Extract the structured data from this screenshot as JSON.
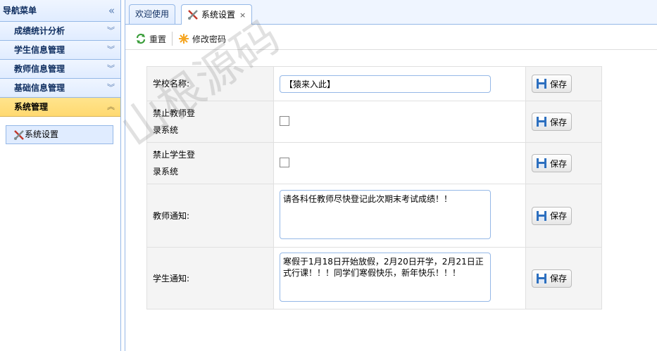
{
  "sidebar": {
    "title": "导航菜单",
    "collapse_glyph": "«",
    "groups": [
      {
        "label": "成绩统计分析",
        "expanded": false
      },
      {
        "label": "学生信息管理",
        "expanded": false
      },
      {
        "label": "教师信息管理",
        "expanded": false
      },
      {
        "label": "基础信息管理",
        "expanded": false
      },
      {
        "label": "系统管理",
        "expanded": true
      }
    ],
    "submenu": [
      {
        "label": "系统设置"
      }
    ]
  },
  "tabs": [
    {
      "label": "欢迎使用",
      "selected": false
    },
    {
      "label": "系统设置",
      "selected": true,
      "close": "×"
    }
  ],
  "toolbar": {
    "reset_label": "重置",
    "change_password_label": "修改密码"
  },
  "settings": [
    {
      "label": "学校名称:",
      "type": "text",
      "value": "【猿来入此】"
    },
    {
      "label": "禁止教师登录系统",
      "type": "checkbox",
      "checked": false
    },
    {
      "label": "禁止学生登录系统",
      "type": "checkbox",
      "checked": false
    },
    {
      "label": "教师通知:",
      "type": "textarea",
      "value": "请各科任教师尽快登记此次期末考试成绩！！"
    },
    {
      "label": "学生通知:",
      "type": "textarea",
      "value": "寒假于1月18日开始放假，2月20日开学，2月21日正式行课！！！同学们寒假快乐，新年快乐！！！"
    }
  ],
  "save_label": "保存",
  "watermark": "山根源码",
  "colors": {
    "border": "#95b8e7",
    "active_menu": "#ffd970",
    "header_bg": "#e0ecff"
  }
}
